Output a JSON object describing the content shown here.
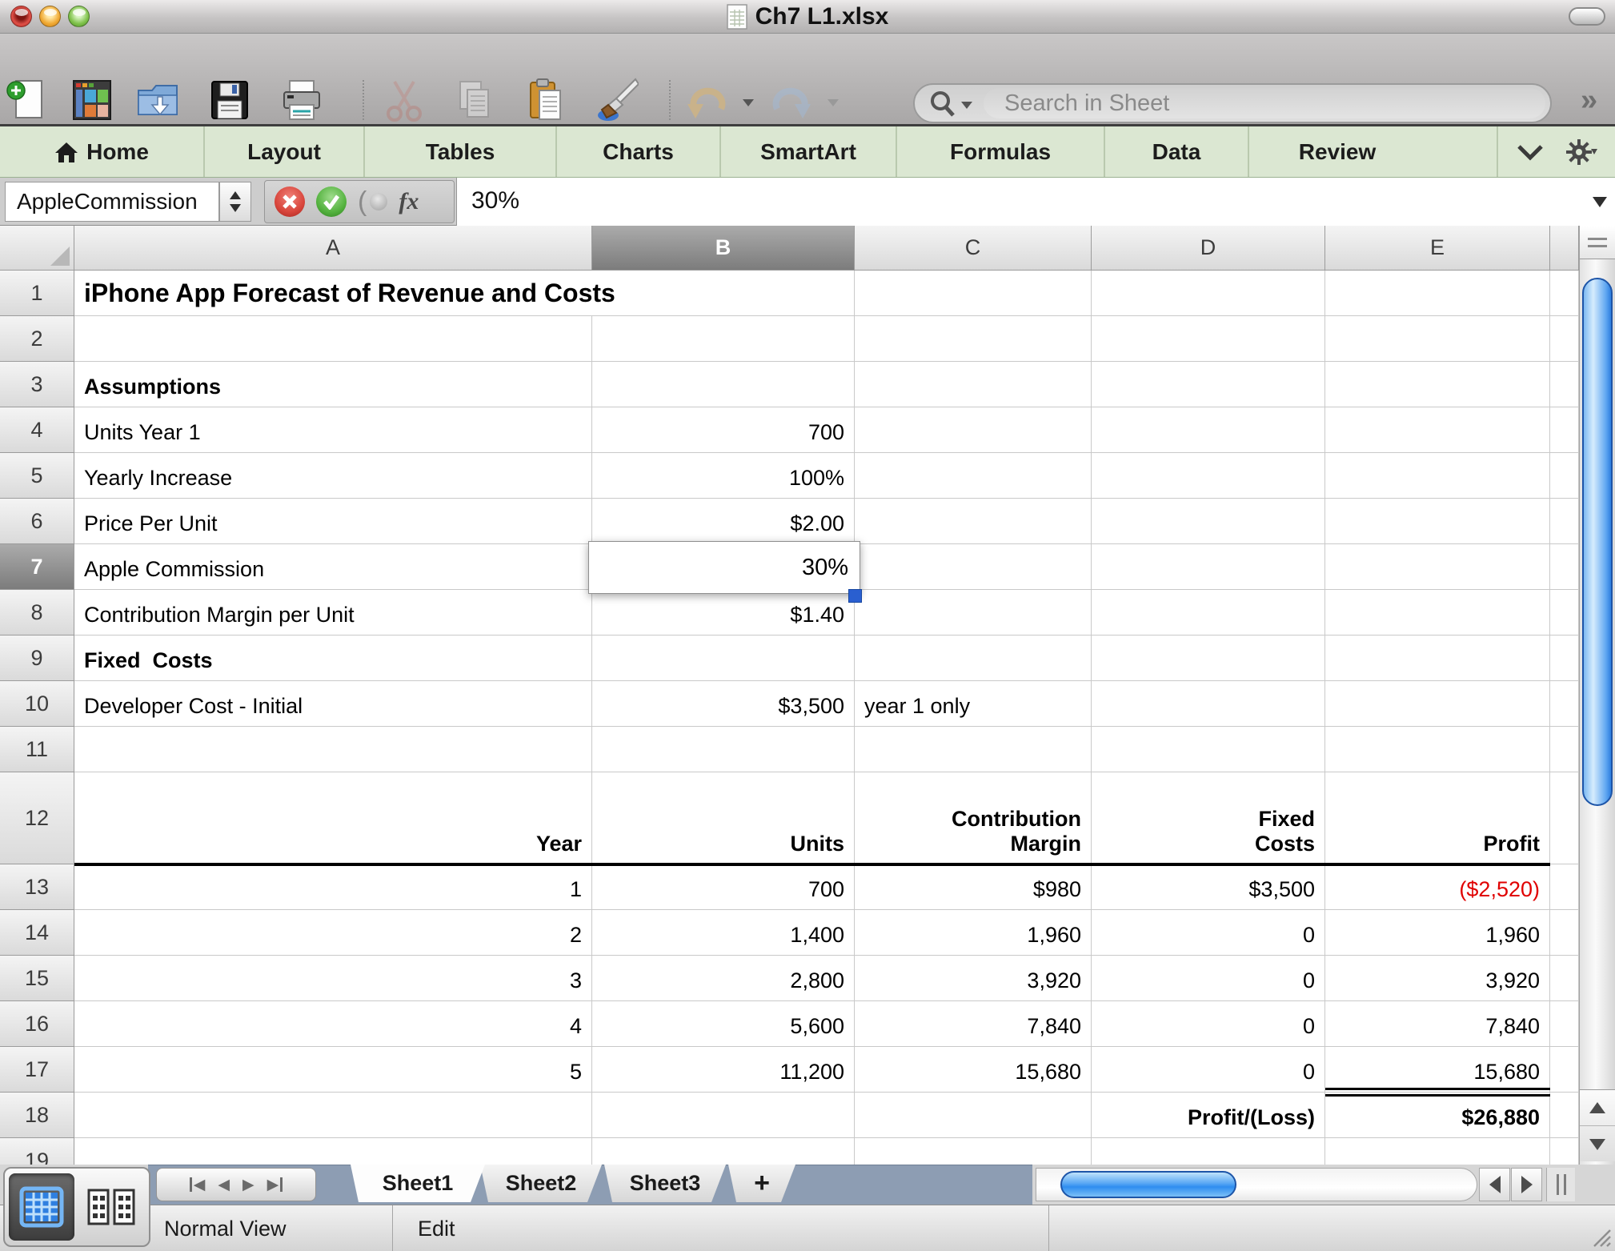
{
  "window": {
    "title": "Ch7 L1.xlsx"
  },
  "toolbar": {
    "search_placeholder": "Search in Sheet",
    "more_indicator": "»",
    "icons": [
      "new-document",
      "template-gallery",
      "open",
      "save",
      "print",
      "cut",
      "copy",
      "paste",
      "format-painter",
      "undo",
      "redo",
      "search"
    ]
  },
  "ribbon": {
    "tabs": [
      "Home",
      "Layout",
      "Tables",
      "Charts",
      "SmartArt",
      "Formulas",
      "Data",
      "Review"
    ]
  },
  "formula_bar": {
    "name_box": "AppleCommission",
    "value": "30%",
    "fx_label": "fx"
  },
  "grid": {
    "columns": [
      "A",
      "B",
      "C",
      "D",
      "E"
    ],
    "selected_column": "B",
    "selected_row": 7,
    "rows": [
      {
        "n": 1,
        "cells": {
          "A": {
            "v": "iPhone App Forecast of Revenue and Costs",
            "s": "title left"
          }
        }
      },
      {
        "n": 2,
        "cells": {}
      },
      {
        "n": 3,
        "cells": {
          "A": {
            "v": "Assumptions",
            "s": "bold left"
          }
        }
      },
      {
        "n": 4,
        "cells": {
          "A": {
            "v": "Units Year 1",
            "s": "left"
          },
          "B": {
            "v": "700",
            "s": "num"
          }
        }
      },
      {
        "n": 5,
        "cells": {
          "A": {
            "v": "Yearly Increase",
            "s": "left"
          },
          "B": {
            "v": "100%",
            "s": "num"
          }
        }
      },
      {
        "n": 6,
        "cells": {
          "A": {
            "v": "Price Per Unit",
            "s": "left"
          },
          "B": {
            "v": "$2.00",
            "s": "num"
          }
        }
      },
      {
        "n": 7,
        "cells": {
          "A": {
            "v": "Apple Commission",
            "s": "left"
          },
          "B": {
            "v": "30%",
            "s": "num edit"
          }
        }
      },
      {
        "n": 8,
        "cells": {
          "A": {
            "v": "Contribution Margin per Unit",
            "s": "left"
          },
          "B": {
            "v": "$1.40",
            "s": "num"
          }
        }
      },
      {
        "n": 9,
        "cells": {
          "A": {
            "v": "Fixed  Costs",
            "s": "bold left"
          }
        }
      },
      {
        "n": 10,
        "cells": {
          "A": {
            "v": "Developer Cost - Initial",
            "s": "left"
          },
          "B": {
            "v": "$3,500",
            "s": "num"
          },
          "C": {
            "v": "year 1 only",
            "s": "left"
          }
        }
      },
      {
        "n": 11,
        "cells": {}
      },
      {
        "n": 12,
        "tall": true,
        "thick_bottom": true,
        "cells": {
          "A": {
            "v": "Year",
            "s": "hdr"
          },
          "B": {
            "v": "Units",
            "s": "hdr"
          },
          "C": {
            "v": "Contribution\nMargin",
            "s": "hdr"
          },
          "D": {
            "v": "Fixed\nCosts",
            "s": "hdr"
          },
          "E": {
            "v": "Profit",
            "s": "hdr"
          }
        }
      },
      {
        "n": 13,
        "cells": {
          "A": {
            "v": "1",
            "s": "num"
          },
          "B": {
            "v": "700",
            "s": "num"
          },
          "C": {
            "v": "$980",
            "s": "num"
          },
          "D": {
            "v": "$3,500",
            "s": "num"
          },
          "E": {
            "v": "($2,520)",
            "s": "num neg"
          }
        }
      },
      {
        "n": 14,
        "cells": {
          "A": {
            "v": "2",
            "s": "num"
          },
          "B": {
            "v": "1,400",
            "s": "num"
          },
          "C": {
            "v": "1,960",
            "s": "num"
          },
          "D": {
            "v": "0",
            "s": "num"
          },
          "E": {
            "v": "1,960",
            "s": "num"
          }
        }
      },
      {
        "n": 15,
        "cells": {
          "A": {
            "v": "3",
            "s": "num"
          },
          "B": {
            "v": "2,800",
            "s": "num"
          },
          "C": {
            "v": "3,920",
            "s": "num"
          },
          "D": {
            "v": "0",
            "s": "num"
          },
          "E": {
            "v": "3,920",
            "s": "num"
          }
        }
      },
      {
        "n": 16,
        "cells": {
          "A": {
            "v": "4",
            "s": "num"
          },
          "B": {
            "v": "5,600",
            "s": "num"
          },
          "C": {
            "v": "7,840",
            "s": "num"
          },
          "D": {
            "v": "0",
            "s": "num"
          },
          "E": {
            "v": "7,840",
            "s": "num"
          }
        }
      },
      {
        "n": 17,
        "cells": {
          "A": {
            "v": "5",
            "s": "num"
          },
          "B": {
            "v": "11,200",
            "s": "num"
          },
          "C": {
            "v": "15,680",
            "s": "num"
          },
          "D": {
            "v": "0",
            "s": "num"
          },
          "E": {
            "v": "15,680",
            "s": "num dbl"
          }
        }
      },
      {
        "n": 18,
        "cells": {
          "D": {
            "v": "Profit/(Loss)",
            "s": "hdr"
          },
          "E": {
            "v": "$26,880",
            "s": "num bold"
          }
        }
      },
      {
        "n": 19,
        "cells": {}
      }
    ]
  },
  "sheet_tabs": {
    "items": [
      "Sheet1",
      "Sheet2",
      "Sheet3"
    ],
    "add_label": "+",
    "active": "Sheet1"
  },
  "status_bar": {
    "view": "Normal View",
    "mode": "Edit"
  },
  "colors": {
    "accent_blue": "#2f8df0",
    "negative_red": "#e00000",
    "ribbon_green": "#dbe7d2",
    "tabbar_slate": "#8d9db3",
    "fill_handle_blue": "#2a5fd0"
  }
}
